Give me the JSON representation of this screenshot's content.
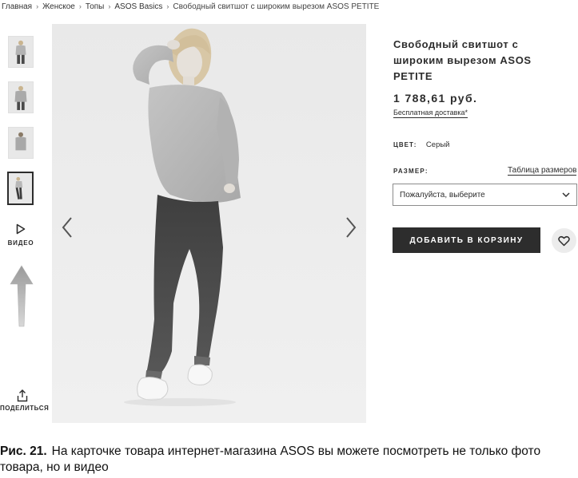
{
  "breadcrumb": [
    "Главная",
    "Женское",
    "Топы",
    "ASOS Basics",
    "Свободный свитшот с широким вырезом ASOS PETITE"
  ],
  "gallery": {
    "thumbnail_count": 4,
    "active_index": 3,
    "video_label": "ВИДЕО",
    "share_label": "ПОДЕЛИТЬСЯ"
  },
  "product": {
    "title": "Свободный свитшот с широким вырезом ASOS PETITE",
    "price": "1 788,61 руб.",
    "delivery": "Бесплатная доставка*",
    "color_label": "ЦВЕТ:",
    "color_value": "Серый",
    "size_label": "РАЗМЕР:",
    "size_guide": "Таблица размеров",
    "size_placeholder": "Пожалуйста, выберите",
    "add_to_cart": "ДОБАВИТЬ В КОРЗИНУ"
  },
  "caption": {
    "figure": "Рис. 21.",
    "text": "На карточке товара интернет-магазина ASOS вы можете посмотреть не только фото товара, но и видео"
  },
  "colors": {
    "primary_dark": "#2d2d2d",
    "photo_background": "#ebebeb",
    "wishlist_background": "#ececec"
  },
  "icons": [
    "play-icon",
    "share-icon",
    "chevron-left-icon",
    "chevron-right-icon",
    "chevron-down-icon",
    "heart-icon",
    "up-arrow-annotation"
  ]
}
